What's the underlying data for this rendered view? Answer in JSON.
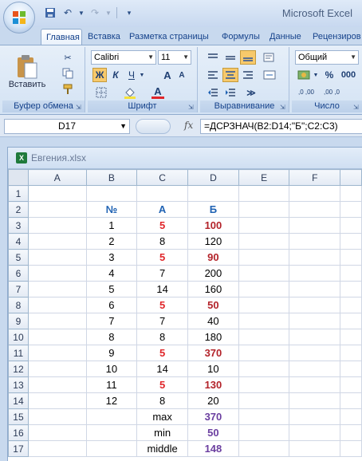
{
  "app": {
    "title": "Microsoft Excel"
  },
  "tabs": [
    "Главная",
    "Вставка",
    "Разметка страницы",
    "Формулы",
    "Данные",
    "Рецензиров"
  ],
  "ribbon": {
    "clipboard": {
      "label": "Буфер обмена",
      "paste_label": "Вставить"
    },
    "font": {
      "label": "Шрифт",
      "font_name": "Calibri",
      "font_size": "11",
      "bold": "Ж",
      "italic": "К",
      "underline": "Ч",
      "grow": "A",
      "shrink": "A",
      "color_letter": "A"
    },
    "alignment": {
      "label": "Выравнивание"
    },
    "number": {
      "label": "Число",
      "format": "Общий",
      "percent": "%",
      "thousands": "000",
      "inc_dec": ",0 ,00",
      "dec_dec": ",00 ,0"
    }
  },
  "formula_bar": {
    "cell": "D17",
    "fx": "fx",
    "formula": "=ДСРЗНАЧ(B2:D14;\"Б\";C2:C3)"
  },
  "workbook": {
    "name": "Евгения.xlsx",
    "columns": [
      "A",
      "B",
      "C",
      "D",
      "E",
      "F"
    ],
    "rows": [
      {
        "n": "1",
        "cells": [
          "",
          "",
          "",
          "",
          "",
          ""
        ]
      },
      {
        "n": "2",
        "cells": [
          "",
          "№",
          "А",
          "Б",
          "",
          ""
        ]
      },
      {
        "n": "3",
        "cells": [
          "",
          "1",
          "5",
          "100",
          "",
          ""
        ]
      },
      {
        "n": "4",
        "cells": [
          "",
          "2",
          "8",
          "120",
          "",
          ""
        ]
      },
      {
        "n": "5",
        "cells": [
          "",
          "3",
          "5",
          "90",
          "",
          ""
        ]
      },
      {
        "n": "6",
        "cells": [
          "",
          "4",
          "7",
          "200",
          "",
          ""
        ]
      },
      {
        "n": "7",
        "cells": [
          "",
          "5",
          "14",
          "160",
          "",
          ""
        ]
      },
      {
        "n": "8",
        "cells": [
          "",
          "6",
          "5",
          "50",
          "",
          ""
        ]
      },
      {
        "n": "9",
        "cells": [
          "",
          "7",
          "7",
          "40",
          "",
          ""
        ]
      },
      {
        "n": "10",
        "cells": [
          "",
          "8",
          "8",
          "180",
          "",
          ""
        ]
      },
      {
        "n": "11",
        "cells": [
          "",
          "9",
          "5",
          "370",
          "",
          ""
        ]
      },
      {
        "n": "12",
        "cells": [
          "",
          "10",
          "14",
          "10",
          "",
          ""
        ]
      },
      {
        "n": "13",
        "cells": [
          "",
          "11",
          "5",
          "130",
          "",
          ""
        ]
      },
      {
        "n": "14",
        "cells": [
          "",
          "12",
          "8",
          "20",
          "",
          ""
        ]
      },
      {
        "n": "15",
        "cells": [
          "",
          "",
          "max",
          "370",
          "",
          ""
        ]
      },
      {
        "n": "16",
        "cells": [
          "",
          "",
          "min",
          "50",
          "",
          ""
        ]
      },
      {
        "n": "17",
        "cells": [
          "",
          "",
          "middle",
          "148",
          "",
          ""
        ]
      }
    ]
  },
  "colors": {
    "header_blue": "#1f62b3",
    "red": "#e0262a",
    "purple": "#6b3fa0"
  }
}
